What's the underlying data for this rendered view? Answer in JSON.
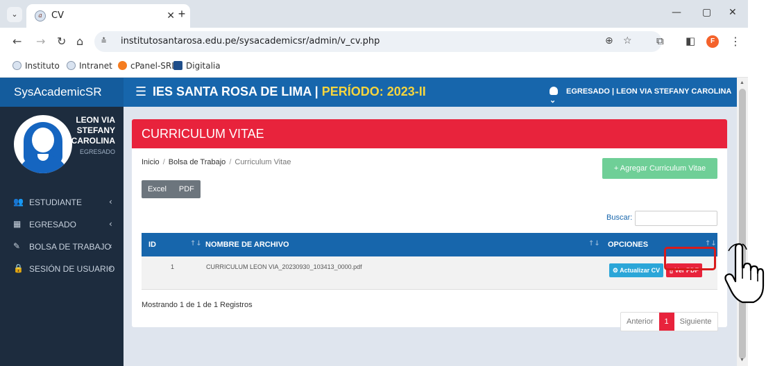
{
  "browser": {
    "tab_title": "CV",
    "url": "institutosantarosa.edu.pe/sysacademicsr/admin/v_cv.php",
    "profile_initial": "F",
    "bookmarks": [
      "Instituto",
      "Intranet",
      "cPanel-SRL",
      "Digitalia"
    ]
  },
  "app": {
    "brand": "SysAcademicSR",
    "title_main": "IES SANTA ROSA DE LIMA | ",
    "title_period": "PERÍODO: 2023-II",
    "user_menu": "EGRESADO | LEON VIA STEFANY CAROLINA"
  },
  "sidebar": {
    "user_name_lines": [
      "LEON VIA",
      "STEFANY",
      "CAROLINA"
    ],
    "user_role": "EGRESADO",
    "items": [
      {
        "label": "ESTUDIANTE",
        "icon": "users-icon"
      },
      {
        "label": "EGRESADO",
        "icon": "graduate-icon"
      },
      {
        "label": "BOLSA DE TRABAJO",
        "icon": "edit-icon"
      },
      {
        "label": "SESIÓN DE USUARIO",
        "icon": "lock-icon"
      }
    ]
  },
  "card": {
    "header": "CURRICULUM VITAE",
    "breadcrumb": [
      "Inicio",
      "Bolsa de Trabajo",
      "Curriculum Vitae"
    ],
    "add_button": "+ Agregar Curriculum Vitae",
    "export_buttons": [
      "Excel",
      "PDF"
    ],
    "search_label": "Buscar:",
    "columns": [
      "ID",
      "NOMBRE DE ARCHIVO",
      "OPCIONES"
    ],
    "rows": [
      {
        "id": "1",
        "file": "CURRICULUM LEON VIA_20230930_103413_0000.pdf"
      }
    ],
    "update_button": "Actualizar CV",
    "view_pdf_button": "Ver PDF",
    "showing": "Mostrando 1 de 1 de 1 Registros",
    "pager": {
      "prev": "Anterior",
      "current": "1",
      "next": "Siguiente"
    }
  },
  "colors": {
    "primary": "#1766ac",
    "header_red": "#e8233c",
    "sidebar": "#1d2c3e",
    "period_yellow": "#f6d53e"
  }
}
